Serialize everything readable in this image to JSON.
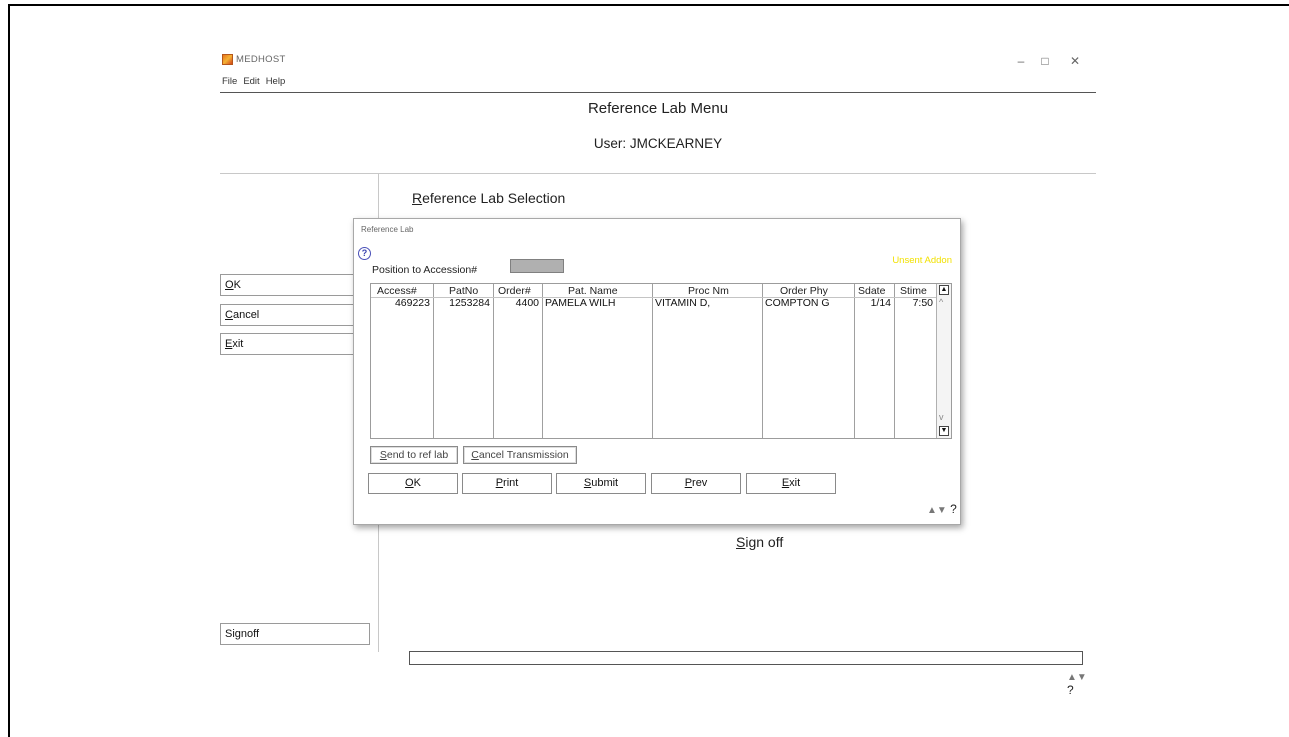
{
  "app": {
    "title": "MEDHOST"
  },
  "window_controls": {
    "minimize": "–",
    "maximize": "□",
    "close": "✕"
  },
  "menu": [
    "File",
    "Edit",
    "Help"
  ],
  "header": {
    "title": "Reference Lab Menu",
    "user": "User: JMCKEARNEY"
  },
  "left_buttons": {
    "ok": {
      "underline": "O",
      "rest": "K"
    },
    "cancel": {
      "underline": "C",
      "rest": "ancel"
    },
    "exit": {
      "underline": "E",
      "rest": "xit"
    },
    "signoff": "Signoff"
  },
  "main": {
    "ref_selection": {
      "underline": "R",
      "rest": "eference Lab Selection"
    },
    "sign_off": {
      "underline": "S",
      "rest": "ign off"
    }
  },
  "dialog": {
    "title": "Reference Lab",
    "help_glyph": "?",
    "position_label": "Position to Accession#",
    "position_value": "",
    "unsent_label": "Unsent Addon",
    "columns": [
      "Access#",
      "PatNo",
      "Order#",
      "Pat. Name",
      "Proc Nm",
      "Order Phy",
      "Sdate",
      "Stime"
    ],
    "rows": [
      [
        "469223",
        "1253284",
        "4400",
        "PAMELA WILH",
        "VITAMIN D,",
        "COMPTON G",
        "1/14",
        "7:50"
      ]
    ],
    "buttons_small": {
      "send": {
        "underline": "S",
        "rest": "end to ref lab"
      },
      "cancel_tx": {
        "underline": "C",
        "rest": "ancel Transmission"
      }
    },
    "buttons": {
      "ok": {
        "underline": "O",
        "rest": "K"
      },
      "print": {
        "underline": "P",
        "rest": "rint"
      },
      "submit": {
        "underline": "S",
        "rest": "ubmit"
      },
      "prev": {
        "underline": "P",
        "rest": "rev"
      },
      "exit": {
        "underline": "E",
        "rest": "xit"
      }
    }
  },
  "help_corner": {
    "arrows": "▲▼",
    "mark": "?"
  },
  "colors": {
    "unsent": "#f2e100",
    "help_icon": "#3b44b0",
    "position_input_bg": "#b0b0b0"
  }
}
